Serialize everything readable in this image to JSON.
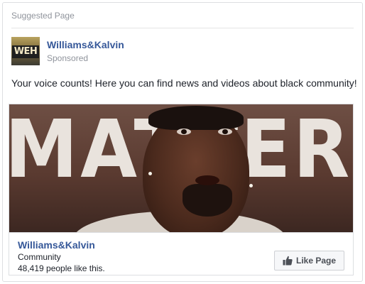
{
  "card": {
    "header": "Suggested Page"
  },
  "author": {
    "logo_text": "WEH",
    "name": "Williams&Kalvin",
    "sponsored": "Sponsored"
  },
  "post": {
    "text": "Your voice counts! Here you can find news and videos about black community!"
  },
  "media": {
    "background_text": "MATTER"
  },
  "footer": {
    "page_name": "Williams&Kalvin",
    "category": "Community",
    "likes": "48,419 people like this.",
    "like_button_label": "Like Page",
    "like_icon": "thumbs-up-icon"
  },
  "colors": {
    "link": "#365899",
    "muted": "#90949c",
    "border": "#dddfe2"
  }
}
